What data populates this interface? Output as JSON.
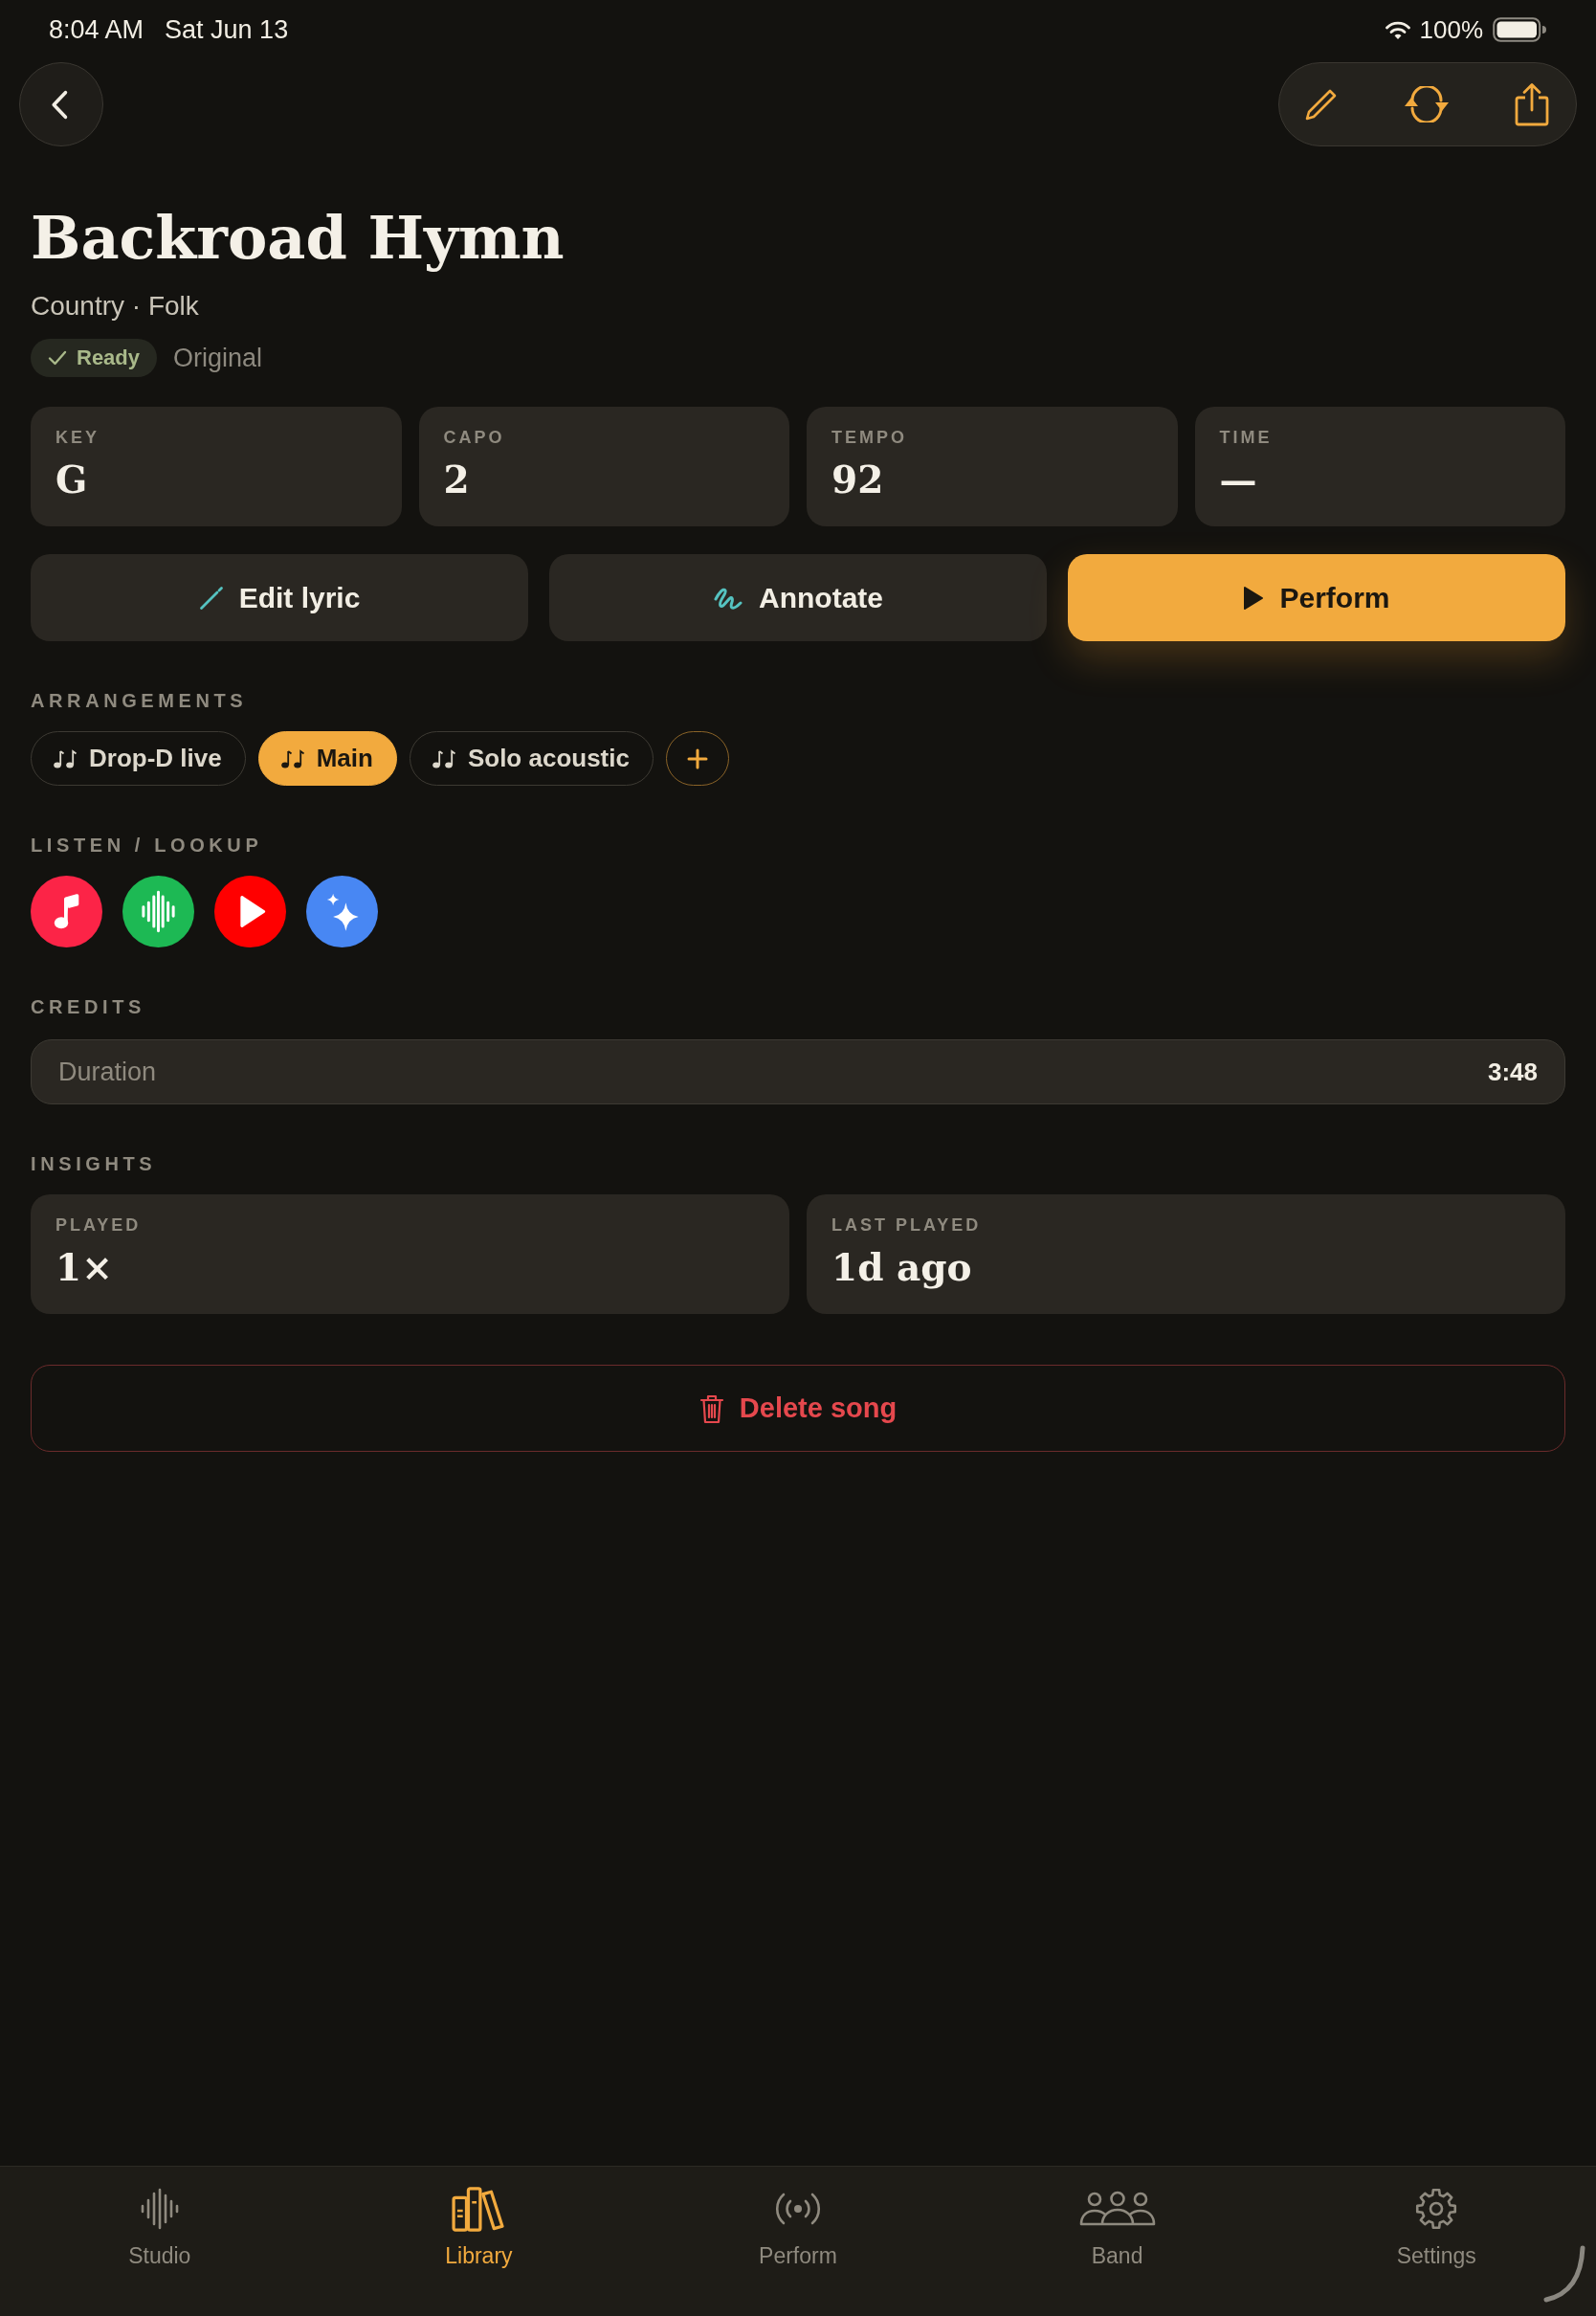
{
  "status_bar": {
    "time": "8:04 AM",
    "date": "Sat Jun 13",
    "battery": "100%"
  },
  "song": {
    "title": "Backroad Hymn",
    "genres": "Country · Folk",
    "status": "Ready",
    "version": "Original"
  },
  "stats": [
    {
      "label": "KEY",
      "value": "G"
    },
    {
      "label": "CAPO",
      "value": "2"
    },
    {
      "label": "TEMPO",
      "value": "92"
    },
    {
      "label": "TIME",
      "value": "—"
    }
  ],
  "actions": [
    {
      "kind": "edit",
      "label": "Edit lyric",
      "primary": false
    },
    {
      "kind": "annotate",
      "label": "Annotate",
      "primary": false
    },
    {
      "kind": "perform",
      "label": "Perform",
      "primary": true
    }
  ],
  "arrangements": {
    "heading": "ARRANGEMENTS",
    "items": [
      {
        "label": "Drop-D live",
        "selected": false
      },
      {
        "label": "Main",
        "selected": true
      },
      {
        "label": "Solo acoustic",
        "selected": false
      }
    ]
  },
  "listen": {
    "heading": "LISTEN / LOOKUP",
    "services": [
      {
        "kind": "music",
        "color": "#fc2447"
      },
      {
        "kind": "waveform",
        "color": "#1db954"
      },
      {
        "kind": "play",
        "color": "#ff0000"
      },
      {
        "kind": "sparkle",
        "color": "#4887f3"
      }
    ]
  },
  "credits": {
    "heading": "CREDITS",
    "rows": [
      {
        "label": "Duration",
        "value": "3:48"
      }
    ]
  },
  "insights": {
    "heading": "INSIGHTS",
    "cards": [
      {
        "label": "PLAYED",
        "value": "1×"
      },
      {
        "label": "LAST PLAYED",
        "value": "1d ago"
      }
    ]
  },
  "delete_button": {
    "label": "Delete song"
  },
  "tab_bar": [
    {
      "kind": "studio",
      "label": "Studio",
      "selected": false
    },
    {
      "kind": "library",
      "label": "Library",
      "selected": true
    },
    {
      "kind": "perform",
      "label": "Perform",
      "selected": false
    },
    {
      "kind": "band",
      "label": "Band",
      "selected": false
    },
    {
      "kind": "settings",
      "label": "Settings",
      "selected": false
    }
  ]
}
